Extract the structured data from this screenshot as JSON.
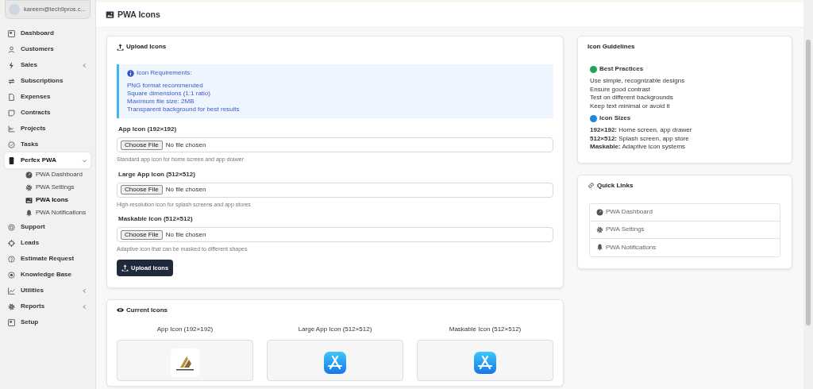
{
  "sidebar": {
    "user": {
      "email": "kareem@tech9pros.c..."
    },
    "items": [
      {
        "label": "Dashboard",
        "selected": false
      },
      {
        "label": "Customers",
        "selected": false
      },
      {
        "label": "Sales",
        "expanded": false,
        "selected": false
      },
      {
        "label": "Subscriptions",
        "selected": false
      },
      {
        "label": "Expenses",
        "selected": false
      },
      {
        "label": "Contracts",
        "selected": false
      },
      {
        "label": "Projects",
        "selected": false
      },
      {
        "label": "Tasks",
        "selected": false
      },
      {
        "label": "Perfex PWA",
        "expanded": true,
        "selected": true,
        "children": [
          {
            "label": "PWA Dashboard",
            "selected": false
          },
          {
            "label": "PWA Settings",
            "selected": false
          },
          {
            "label": "PWA Icons",
            "selected": true
          },
          {
            "label": "PWA Notifications",
            "selected": false
          }
        ]
      },
      {
        "label": "Support",
        "selected": false
      },
      {
        "label": "Leads",
        "selected": false
      },
      {
        "label": "Estimate Request",
        "selected": false
      },
      {
        "label": "Knowledge Base",
        "selected": false
      },
      {
        "label": "Utilities",
        "expanded": false,
        "selected": false
      },
      {
        "label": "Reports",
        "expanded": false,
        "selected": false
      },
      {
        "label": "Setup",
        "selected": false
      }
    ]
  },
  "page_title": "PWA Icons",
  "upload_card": {
    "title": "Upload Icons",
    "requirements": {
      "title": "Icon Requirements:",
      "lines": [
        "PNG format recommended",
        "Square dimensions (1:1 ratio)",
        "Maximum file size: 2MB",
        "Transparent background for best results"
      ]
    },
    "fields": [
      {
        "label": "App Icon (192×192)",
        "button": "Choose File",
        "value": "No file chosen",
        "help": "Standard app icon for home screen and app drawer"
      },
      {
        "label": "Large App Icon (512×512)",
        "button": "Choose File",
        "value": "No file chosen",
        "help": "High-resolution icon for splash screens and app stores"
      },
      {
        "label": "Maskable Icon (512×512)",
        "button": "Choose File",
        "value": "No file chosen",
        "help": "Adaptive icon that can be masked to different shapes"
      }
    ],
    "submit": "Upload Icons"
  },
  "current_card": {
    "title": "Current Icons",
    "previews": [
      {
        "label": "App Icon (192×192)",
        "kind": "logo"
      },
      {
        "label": "Large App Icon (512×512)",
        "kind": "appstore"
      },
      {
        "label": "Maskable Icon (512×512)",
        "kind": "appstore"
      }
    ]
  },
  "guidelines_card": {
    "title": "Icon Guidelines",
    "sections": [
      {
        "title": "Best Practices",
        "color": "#22a35a",
        "lines": [
          "Use simple, recognizable designs",
          "Ensure good contrast",
          "Test on different backgrounds",
          "Keep text minimal or avoid it"
        ]
      },
      {
        "title": "Icon Sizes",
        "color": "#1e88d6",
        "lines": [
          "**192×192:** Home screen, app drawer",
          "**512×512:** Splash screen, app store",
          "**Maskable:** Adaptive icon systems"
        ]
      }
    ]
  },
  "links_card": {
    "title": "Quick Links",
    "links": [
      "PWA Dashboard",
      "PWA Settings",
      "PWA Notifications"
    ]
  }
}
